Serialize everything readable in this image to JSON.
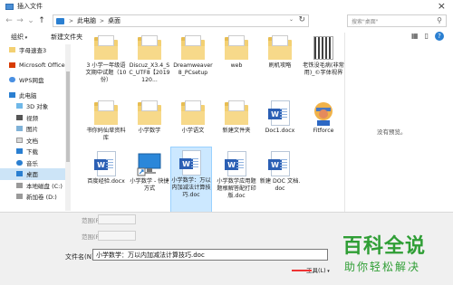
{
  "window": {
    "title": "插入文件",
    "close_glyph": "×"
  },
  "nav": {
    "back": "←",
    "forward": "→",
    "recent": "⌄",
    "up": "↑"
  },
  "address": {
    "segments": [
      "此电脑",
      "桌面"
    ],
    "separator": ">",
    "dropdown": "⌄",
    "refresh": "↻"
  },
  "search": {
    "placeholder": "搜索\"桌面\"",
    "icon": "search-icon"
  },
  "toolbar": {
    "organize": "组织",
    "new_folder": "新建文件夹",
    "help": "?"
  },
  "sidebar": {
    "items": [
      {
        "label": "字母速查3",
        "icon": "folder-icon"
      },
      {
        "label": "Microsoft Office",
        "icon": "office-icon"
      },
      {
        "label": "WPS网盘",
        "icon": "cloud-icon"
      },
      {
        "label": "此电脑",
        "icon": "pc-icon"
      },
      {
        "label": "3D 对象",
        "icon": "3d-icon"
      },
      {
        "label": "视频",
        "icon": "video-icon"
      },
      {
        "label": "图片",
        "icon": "picture-icon"
      },
      {
        "label": "文档",
        "icon": "document-icon"
      },
      {
        "label": "下载",
        "icon": "download-icon"
      },
      {
        "label": "音乐",
        "icon": "music-icon"
      },
      {
        "label": "桌面",
        "icon": "desktop-icon"
      },
      {
        "label": "本地磁盘 (C:)",
        "icon": "drive-icon"
      },
      {
        "label": "新加卷 (D:)",
        "icon": "drive-icon"
      }
    ]
  },
  "files": [
    {
      "label": "3 小学一年级语文期中试题（10份）",
      "kind": "folder"
    },
    {
      "label": "Discuz_X3.4_SC_UTF8【2019120...",
      "kind": "folder"
    },
    {
      "label": "Dreamweaver8_PCsetup",
      "kind": "folder"
    },
    {
      "label": "web",
      "kind": "folder"
    },
    {
      "label": "刷机攻略",
      "kind": "folder"
    },
    {
      "label": "老铁没毛病(非常用)_©字体视界",
      "kind": "qr"
    },
    {
      "label": "书你妈仙草资料库",
      "kind": "folder"
    },
    {
      "label": "小学数学",
      "kind": "folder"
    },
    {
      "label": "小学语文",
      "kind": "folder"
    },
    {
      "label": "新建文件夹",
      "kind": "folder"
    },
    {
      "label": "Doc1.docx",
      "kind": "doc"
    },
    {
      "label": "Fitforce",
      "kind": "app"
    },
    {
      "label": "百度经验.docx",
      "kind": "doc"
    },
    {
      "label": "小学数学 - 快捷方式",
      "kind": "shortcut"
    },
    {
      "label": "小学数学：万以内加减法计算技巧.doc",
      "kind": "doc",
      "selected": true
    },
    {
      "label": "小学数学应用题题根解答配打印版.doc",
      "kind": "doc"
    },
    {
      "label": "新建 DOC 文档.doc",
      "kind": "doc"
    }
  ],
  "preview": {
    "empty_text": "没有预览。"
  },
  "bottom": {
    "range_label": "范围(R):",
    "filename_label": "文件名(N):",
    "filename_value": "小学数学：万以内加减法计算技巧.doc",
    "tools_label": "工具(L)"
  },
  "watermark": {
    "title": "百科全说",
    "subtitle": "助你轻松解决"
  },
  "colors": {
    "accent": "#2a7fd1",
    "selection": "#cce8ff",
    "folder": "#f3d072",
    "word": "#2b5fb4",
    "watermark": "#2f9e35",
    "annotation": "#e33333"
  }
}
